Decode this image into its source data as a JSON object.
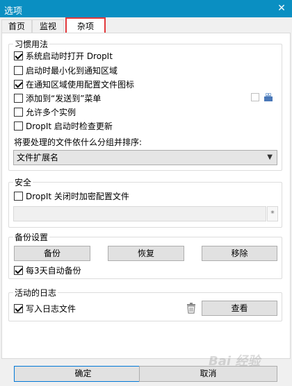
{
  "window": {
    "title": "选项",
    "close": "✕"
  },
  "tabs": [
    {
      "label": "首页"
    },
    {
      "label": "监视"
    },
    {
      "label": "杂项"
    }
  ],
  "habits": {
    "title": "习惯用法",
    "options": [
      {
        "label": "系统启动时打开 DropIt",
        "checked": true
      },
      {
        "label": "启动时最小化到通知区域",
        "checked": false
      },
      {
        "label": "在通知区域使用配置文件图标",
        "checked": true
      },
      {
        "label": "添加到“发送到”菜单",
        "checked": false
      },
      {
        "label": "允许多个实例",
        "checked": false
      },
      {
        "label": "DropIt 启动时检查更新",
        "checked": false
      }
    ],
    "group_label": "将要处理的文件依什么分组并排序:",
    "group_value": "文件扩展名"
  },
  "security": {
    "title": "安全",
    "encrypt_label": "DropIt 关闭时加密配置文件",
    "encrypt_checked": false,
    "password_value": "",
    "reveal_symbol": "*"
  },
  "backup": {
    "title": "备份设置",
    "backup_btn": "备份",
    "restore_btn": "恢复",
    "remove_btn": "移除",
    "auto_label": "每3天自动备份",
    "auto_checked": true
  },
  "log": {
    "title": "活动的日志",
    "write_label": "写入日志文件",
    "write_checked": true,
    "view_btn": "查看"
  },
  "footer": {
    "ok": "确定",
    "cancel": "取消"
  },
  "watermark": "Bai 经验"
}
